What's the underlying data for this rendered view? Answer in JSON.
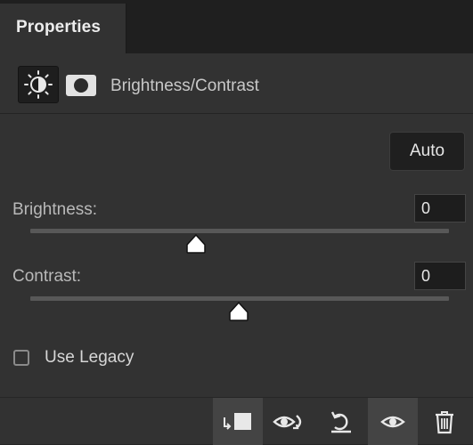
{
  "panel": {
    "tab_label": "Properties",
    "adjustment_title": "Brightness/Contrast",
    "auto_label": "Auto"
  },
  "brightness": {
    "label": "Brightness:",
    "value": "0",
    "level": 0
  },
  "contrast": {
    "label": "Contrast:",
    "value": "0",
    "level": 0
  },
  "legacy": {
    "label": "Use Legacy",
    "checked": false
  },
  "footer": {
    "buttons": [
      {
        "icon": "clip-to-layer-icon",
        "active": true
      },
      {
        "icon": "view-previous-state-icon",
        "active": false
      },
      {
        "icon": "reset-icon",
        "active": false
      },
      {
        "icon": "visibility-eye-icon",
        "active": true
      },
      {
        "icon": "trash-icon",
        "active": false
      }
    ]
  },
  "colors": {
    "background": "#323232",
    "field": "#1d1d1d",
    "text": "#d6d6d6"
  }
}
